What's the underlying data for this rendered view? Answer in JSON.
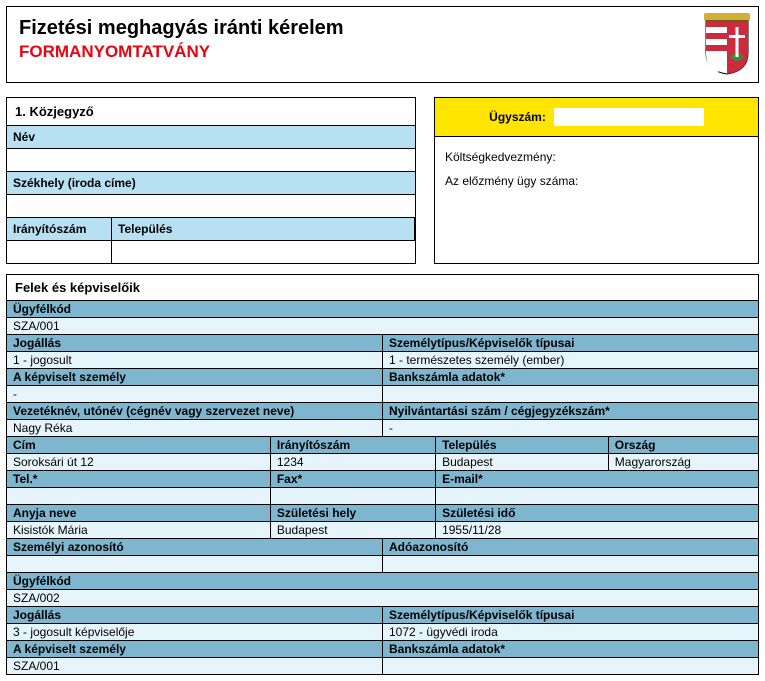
{
  "header": {
    "title": "Fizetési meghagyás iránti kérelem",
    "subtitle": "FORMANYOMTATVÁNY"
  },
  "notary": {
    "section": "1. Közjegyző",
    "name_label": "Név",
    "hq_label": "Székhely (iroda címe)",
    "zip_label": "Irányítószám",
    "town_label": "Település"
  },
  "caseBox": {
    "caseNoLabel": "Ügyszám:",
    "discountLabel": "Költségkedvezmény:",
    "prevCaseLabel": "Az előzmény ügy száma:"
  },
  "parties": {
    "head": "Felek és képviselőik",
    "labels": {
      "clientCode": "Ügyfélkód",
      "status": "Jogállás",
      "personType": "Személytípus/Képviselők típusai",
      "represented": "A képviselt személy",
      "bank": "Bankszámla adatok*",
      "fullname": "Vezetéknév, utónév (cégnév vagy szervezet neve)",
      "regno": "Nyilvántartási szám / cégjegyzékszám*",
      "address": "Cím",
      "zip": "Irányítószám",
      "town": "Település",
      "country": "Ország",
      "tel": "Tel.*",
      "fax": "Fax*",
      "email": "E-mail*",
      "mother": "Anyja neve",
      "birthplace": "Születési hely",
      "birthdate": "Születési idő",
      "personalId": "Személyi azonosító",
      "taxId": "Adóazonosító"
    },
    "p1": {
      "clientCode": "SZA/001",
      "status": "1 - jogosult",
      "personType": "1 - természetes személy (ember)",
      "represented": "-",
      "bank": "",
      "fullname": "Nagy Réka",
      "regno": "-",
      "address": "Soroksári út 12",
      "zip": "1234",
      "town": "Budapest",
      "country": "Magyarország",
      "tel": "",
      "fax": "",
      "email": "",
      "mother": "Kisistók Mária",
      "birthplace": "Budapest",
      "birthdate": "1955/11/28",
      "personalId": "",
      "taxId": ""
    },
    "p2": {
      "clientCode": "SZA/002",
      "status": "3 - jogosult képviselője",
      "personType": "1072 - ügyvédi iroda",
      "represented": "SZA/001",
      "bank": ""
    }
  }
}
